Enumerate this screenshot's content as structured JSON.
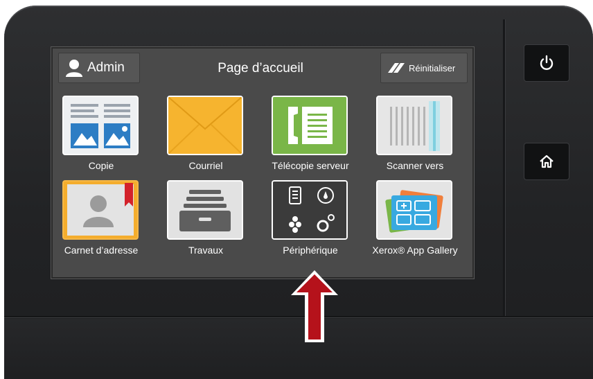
{
  "header": {
    "admin_label": "Admin",
    "title": "Page d’accueil",
    "reset_label": "Réinitialiser"
  },
  "apps": [
    {
      "label": "Copie",
      "icon": "copy-icon"
    },
    {
      "label": "Courriel",
      "icon": "email-envelope-icon"
    },
    {
      "label": "Télécopie serveur",
      "icon": "server-fax-icon"
    },
    {
      "label": "Scanner vers",
      "icon": "scan-to-icon"
    },
    {
      "label": "Carnet d’adresse",
      "icon": "address-book-icon"
    },
    {
      "label": "Travaux",
      "icon": "jobs-tray-icon"
    },
    {
      "label": "Périphérique",
      "icon": "device-icon"
    },
    {
      "label": "Xerox® App Gallery",
      "icon": "app-gallery-icon"
    }
  ],
  "hardware": {
    "power_icon": "power-icon",
    "home_icon": "home-icon"
  },
  "annotation": {
    "arrow_color": "#b5121b",
    "arrow_icon": "up-arrow-icon"
  },
  "colors": {
    "screen_bg": "#4a4a4a",
    "fax_green": "#7ab648",
    "email_yellow": "#f7b731"
  }
}
